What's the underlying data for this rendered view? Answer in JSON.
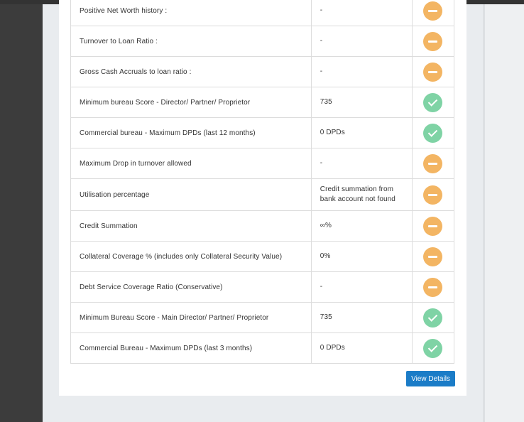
{
  "criteria": {
    "rows": [
      {
        "label": "Positive Net Worth history :",
        "value": "-",
        "status": "neutral"
      },
      {
        "label": "Turnover to Loan Ratio :",
        "value": "-",
        "status": "neutral"
      },
      {
        "label": "Gross Cash Accruals to loan ratio :",
        "value": "-",
        "status": "neutral"
      },
      {
        "label": "Minimum bureau Score - Director/ Partner/ Proprietor",
        "value": "735",
        "status": "pass"
      },
      {
        "label": "Commercial bureau - Maximum DPDs (last 12 months)",
        "value": "0 DPDs",
        "status": "pass"
      },
      {
        "label": "Maximum Drop in turnover allowed",
        "value": "-",
        "status": "neutral"
      },
      {
        "label": "Utilisation percentage",
        "value": "Credit summation from bank account not found",
        "status": "neutral"
      },
      {
        "label": "Credit Summation",
        "value": "∞%",
        "status": "neutral"
      },
      {
        "label": "Collateral Coverage % (includes only Collateral Security Value)",
        "value": "0%",
        "status": "neutral"
      },
      {
        "label": "Debt Service Coverage Ratio (Conservative)",
        "value": "-",
        "status": "neutral"
      },
      {
        "label": "Minimum Bureau Score - Main Director/ Partner/ Proprietor",
        "value": "735",
        "status": "pass"
      },
      {
        "label": "Commercial Bureau - Maximum DPDs (last 3 months)",
        "value": "0 DPDs",
        "status": "pass"
      }
    ]
  },
  "actions": {
    "view_details_label": "View Details"
  },
  "colors": {
    "neutral": "#f3b563",
    "pass": "#7fd3a5",
    "primary_button": "#1b7cc7"
  }
}
